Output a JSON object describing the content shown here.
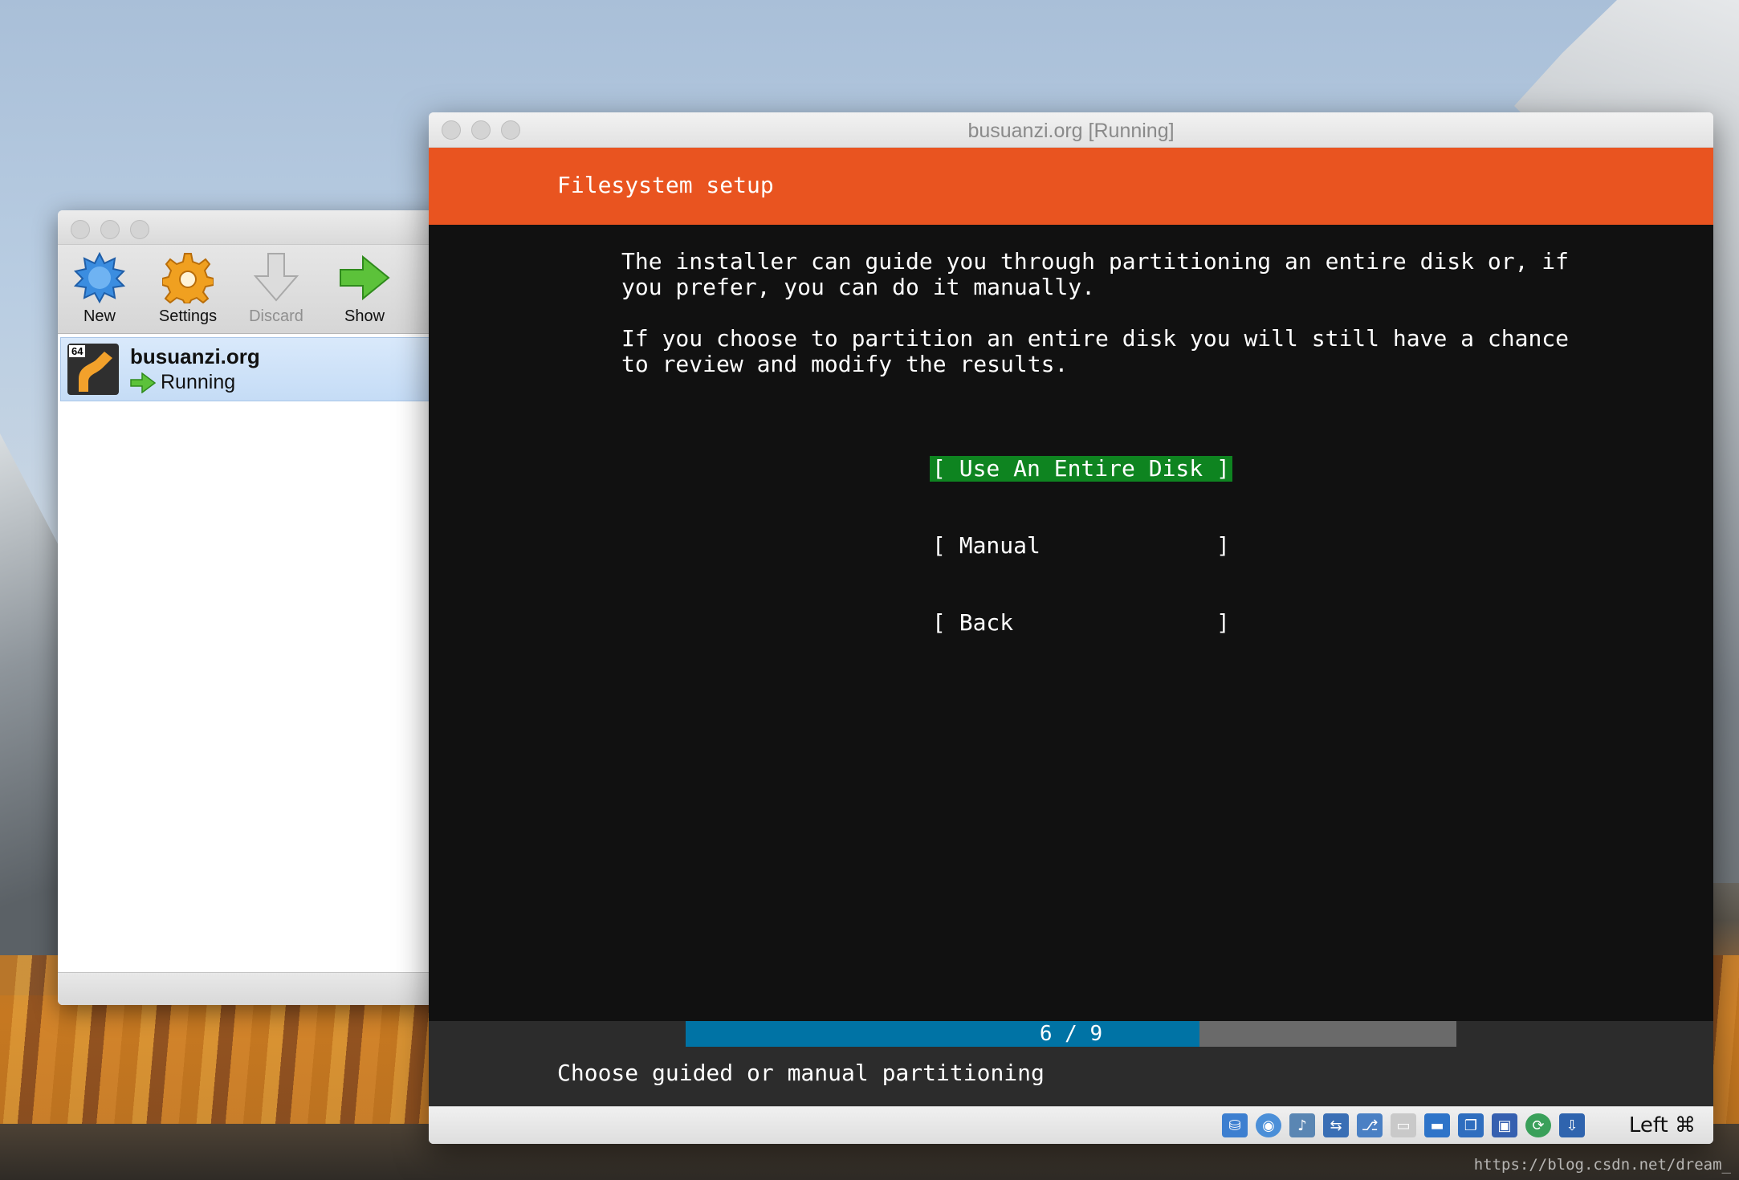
{
  "manager": {
    "toolbar": {
      "new_label": "New",
      "settings_label": "Settings",
      "discard_label": "Discard",
      "show_label": "Show"
    },
    "vm": {
      "badge": "64",
      "name": "busuanzi.org",
      "state": "Running"
    }
  },
  "vm_window": {
    "title": "busuanzi.org [Running]",
    "header": "Filesystem setup",
    "paragraph1_line1": "The installer can guide you through partitioning an entire disk or, if",
    "paragraph1_line2": "you prefer, you can do it manually.",
    "paragraph2_line1": "If you choose to partition an entire disk you will still have a chance",
    "paragraph2_line2": "to review and modify the results.",
    "options": [
      "[ Use An Entire Disk ]",
      "[ Manual             ]",
      "[ Back               ]"
    ],
    "selected_option_index": 0,
    "progress": {
      "text": "6 / 9",
      "current": 6,
      "total": 9
    },
    "footer": "Choose guided or manual partitioning",
    "host_key": "Left ⌘"
  },
  "watermark": "https://blog.csdn.net/dream_",
  "colors": {
    "ubuntu_orange": "#e95420",
    "selected_green": "#0e8420",
    "progress_blue": "#0073a5",
    "terminal_bg": "#111111"
  },
  "status_icons": [
    "hard-disk-icon",
    "optical-disc-icon",
    "audio-icon",
    "network-icon",
    "usb-icon",
    "shared-folder-icon",
    "display-icon",
    "video-capture-icon",
    "cpu-icon",
    "arrows-icon",
    "mouse-integration-icon"
  ]
}
